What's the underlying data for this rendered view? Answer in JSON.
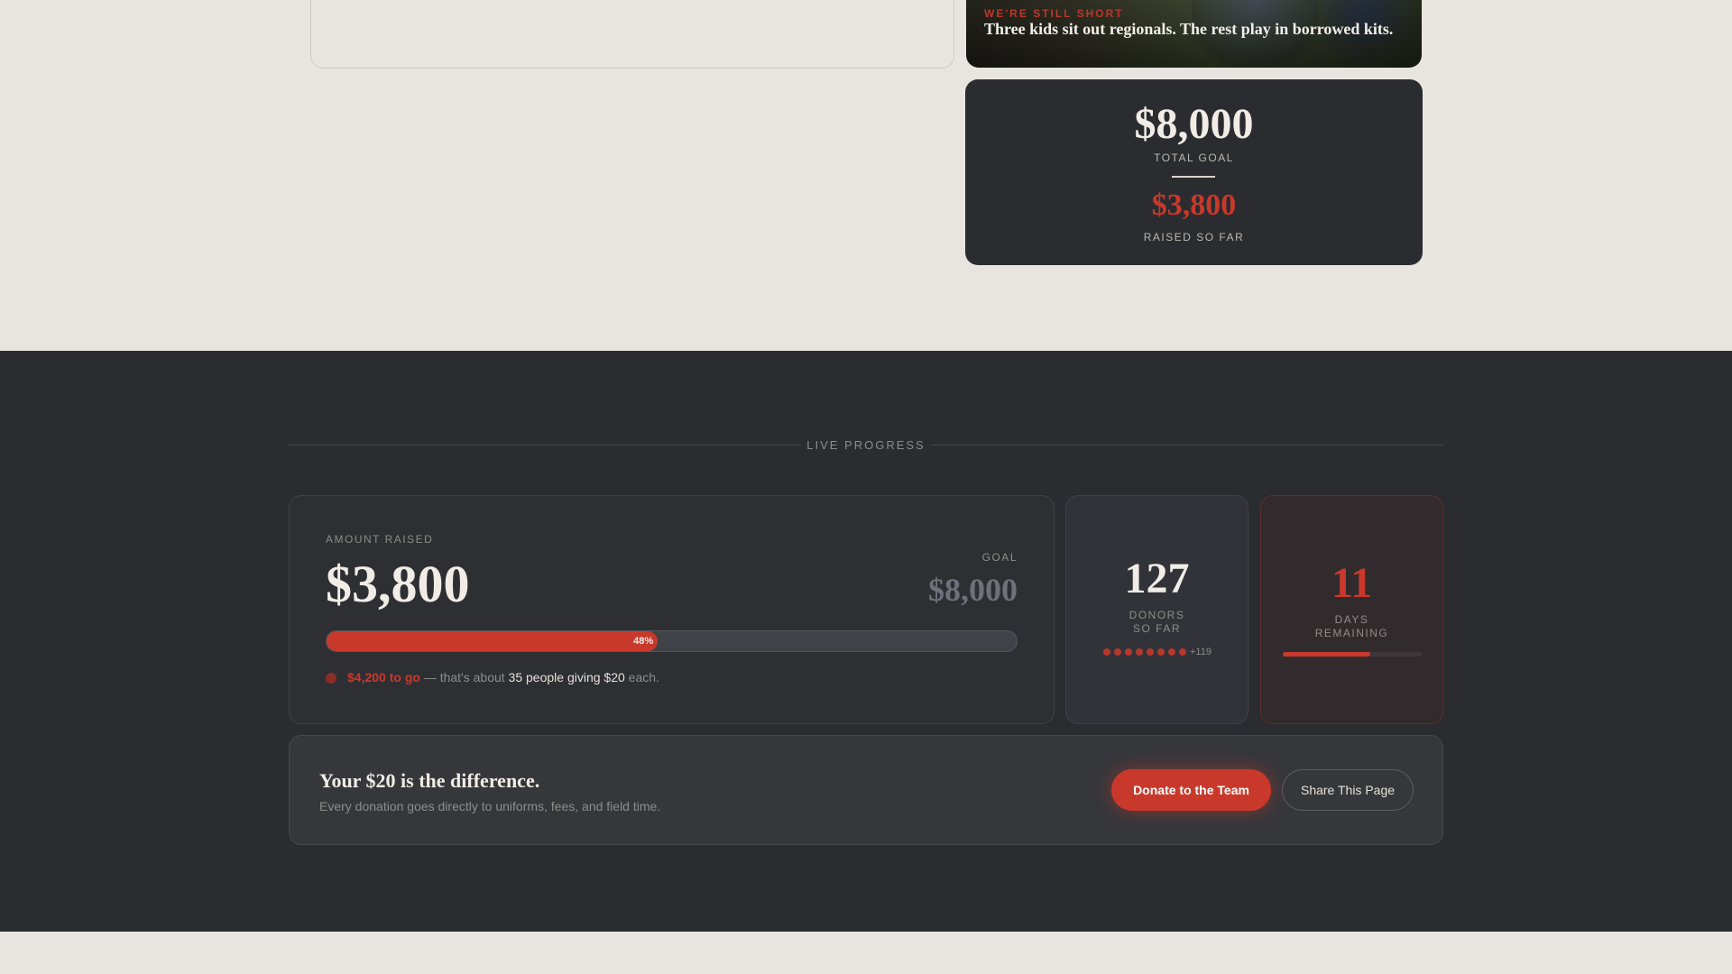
{
  "hero": {
    "kicker": "WE'RE STILL SHORT",
    "caption": "Three kids sit out regionals. The rest play in borrowed kits."
  },
  "goal_summary": {
    "total_goal": "$8,000",
    "total_goal_label": "TOTAL GOAL",
    "raised": "$3,800",
    "raised_label": "RAISED SO FAR"
  },
  "live_progress": {
    "section_label": "LIVE PROGRESS",
    "amount_label": "AMOUNT RAISED",
    "amount": "$3,800",
    "goal_label": "GOAL",
    "goal": "$8,000",
    "progress_percent": 48,
    "progress_label": "48%",
    "to_go": "$4,200 to go",
    "to_go_mid": " — that's about ",
    "to_go_people": "35 people giving $20",
    "to_go_end": " each."
  },
  "donors": {
    "count": "127",
    "label_line1": "DONORS",
    "label_line2": "SO FAR",
    "dot_count": 8,
    "more": "+119"
  },
  "days": {
    "count": "11",
    "label_line1": "DAYS",
    "label_line2": "REMAINING",
    "bar_fraction": 0.63
  },
  "cta": {
    "title": "Your $20 is the difference.",
    "subtitle": "Every donation goes directly to uniforms, fees, and field time.",
    "donate_label": "Donate to the Team",
    "share_label": "Share This Page"
  },
  "colors": {
    "accent": "#c9392b",
    "dark": "#2b2c30",
    "light": "#e8e5e0"
  }
}
